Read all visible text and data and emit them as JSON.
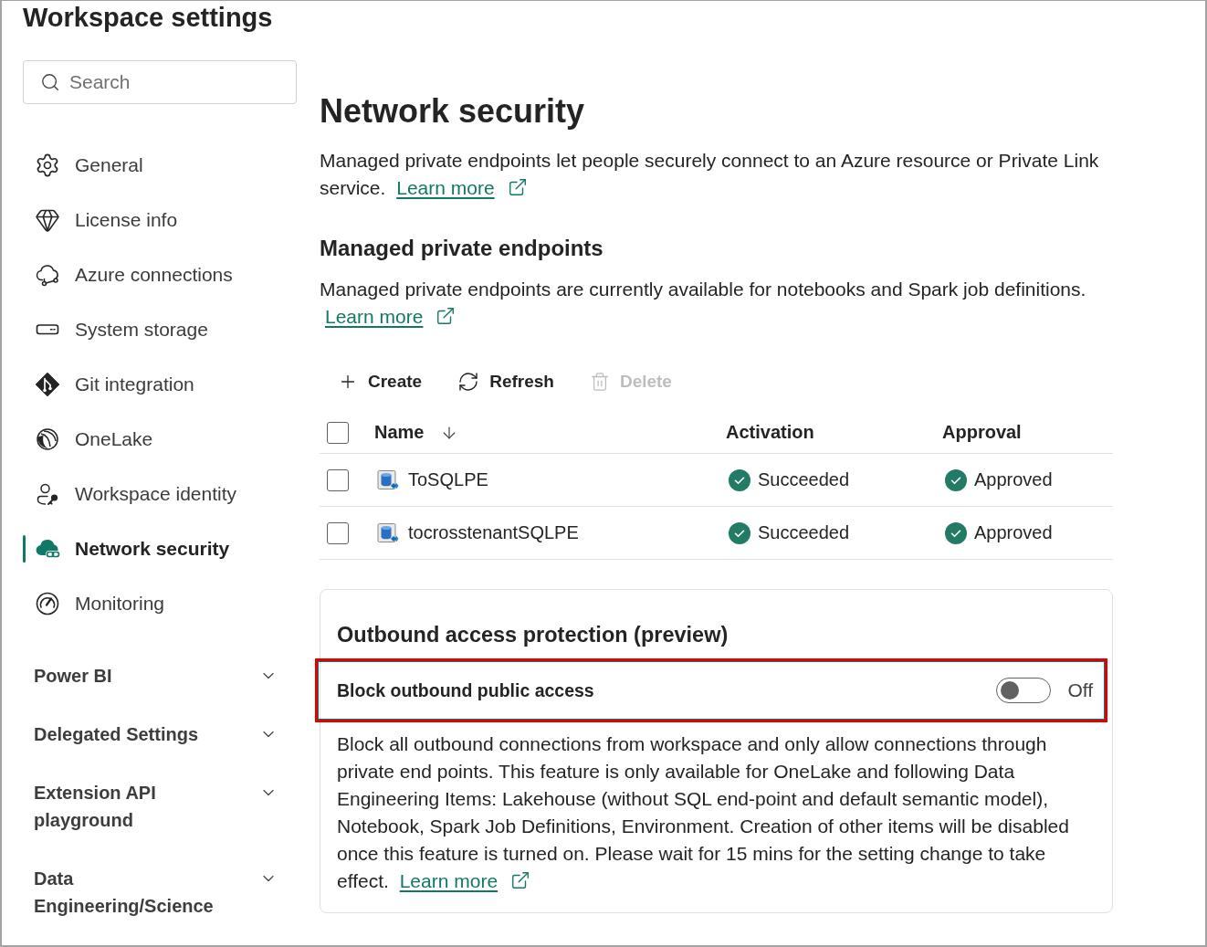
{
  "window": {
    "title": "Workspace settings"
  },
  "sidebar": {
    "search": {
      "placeholder": "Search"
    },
    "items": [
      {
        "label": "General",
        "selected": false
      },
      {
        "label": "License info",
        "selected": false
      },
      {
        "label": "Azure connections",
        "selected": false
      },
      {
        "label": "System storage",
        "selected": false
      },
      {
        "label": "Git integration",
        "selected": false
      },
      {
        "label": "OneLake",
        "selected": false
      },
      {
        "label": "Workspace identity",
        "selected": false
      },
      {
        "label": "Network security",
        "selected": true
      },
      {
        "label": "Monitoring",
        "selected": false
      }
    ],
    "groups": [
      {
        "label": "Power BI",
        "expanded": false
      },
      {
        "label": "Delegated Settings",
        "expanded": false
      },
      {
        "label": "Extension API playground",
        "expanded": false
      },
      {
        "label": "Data Engineering/Science",
        "expanded": false
      }
    ]
  },
  "page": {
    "title": "Network security",
    "intro": {
      "text": "Managed private endpoints let people securely connect to an Azure resource or Private Link service.",
      "link": "Learn more"
    },
    "section": {
      "title": "Managed private endpoints",
      "text": "Managed private endpoints are currently available for notebooks and Spark job definitions.",
      "link": "Learn more"
    },
    "toolbar": [
      {
        "label": "Create",
        "disabled": false
      },
      {
        "label": "Refresh",
        "disabled": false
      },
      {
        "label": "Delete",
        "disabled": true
      }
    ],
    "table": {
      "select_all": {
        "checked": false
      },
      "columns": [
        {
          "label": "Name",
          "sorted": true
        },
        {
          "label": "Activation",
          "sorted": false
        },
        {
          "label": "Approval",
          "sorted": false
        }
      ],
      "rows": [
        {
          "checked": false,
          "name": "ToSQLPE",
          "activation": "Succeeded",
          "approval": "Approved"
        },
        {
          "checked": false,
          "name": "tocrosstenantSQLPE",
          "activation": "Succeeded",
          "approval": "Approved"
        }
      ]
    },
    "outbound": {
      "title": "Outbound access protection (preview)",
      "setting": {
        "label": "Block outbound public access",
        "on": false,
        "state_label": "Off",
        "highlighted": true
      },
      "description": "Block all outbound connections from workspace and only allow connections through private end points. This feature is only available for OneLake and following Data Engineering Items: Lakehouse (without SQL end-point and default semantic model), Notebook, Spark Job Definitions, Environment. Creation of other items will be disabled once this feature is turned on. Please wait for 15 mins for the setting change to take effect.",
      "link": "Learn more"
    }
  }
}
